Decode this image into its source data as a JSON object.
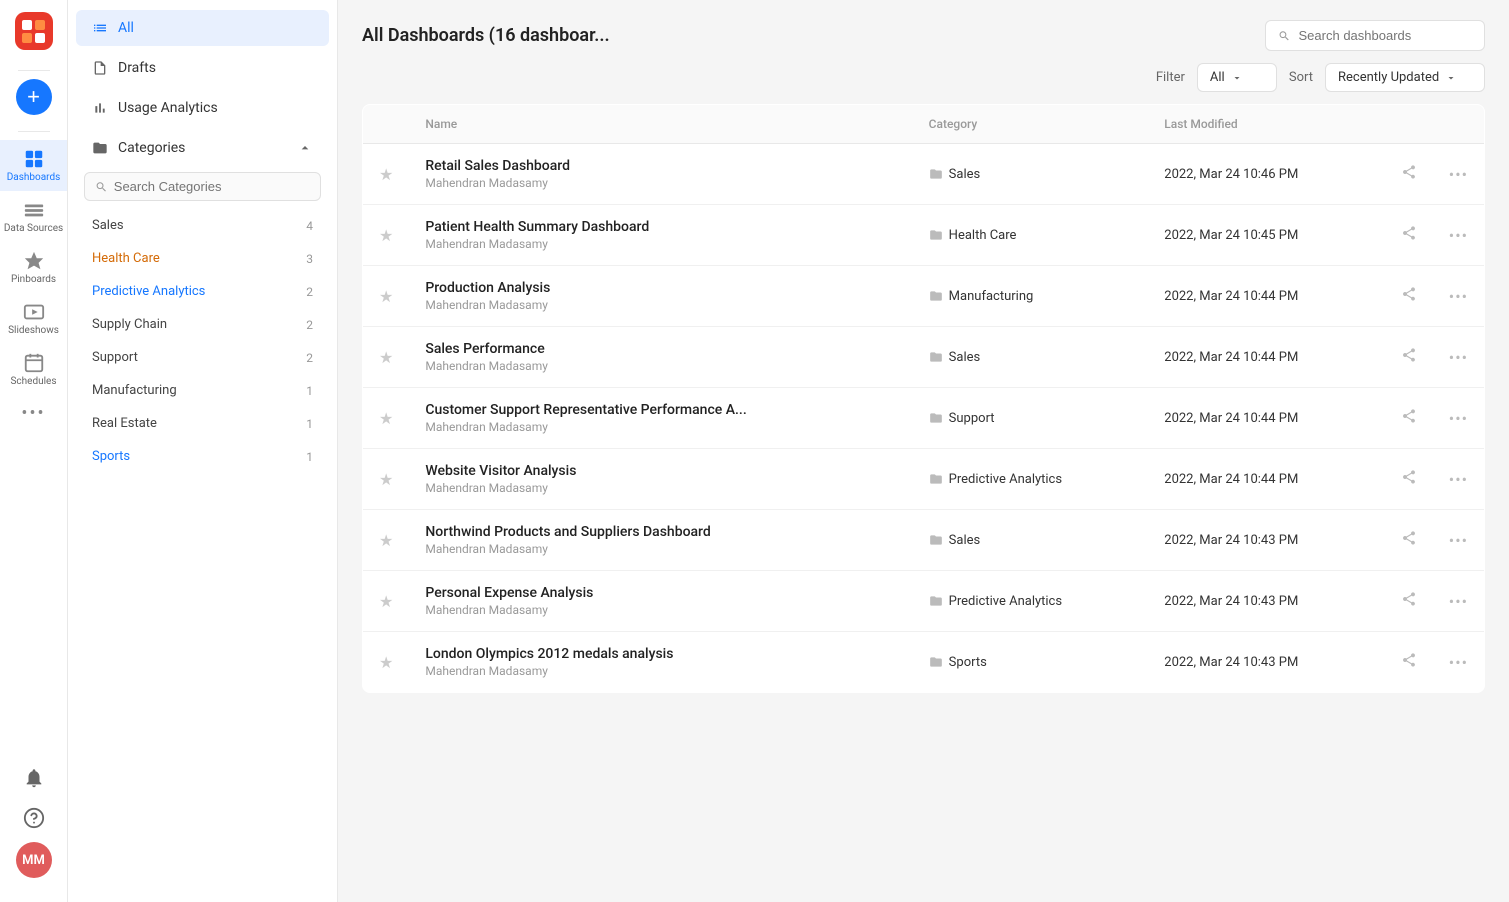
{
  "app": {
    "title": "All Dashboards (16 dashboar..."
  },
  "iconbar": {
    "nav_items": [
      {
        "id": "dashboards",
        "label": "Dashboards",
        "active": true
      },
      {
        "id": "data-sources",
        "label": "Data Sources",
        "active": false
      },
      {
        "id": "pinboards",
        "label": "Pinboards",
        "active": false
      },
      {
        "id": "slideshows",
        "label": "Slideshows",
        "active": false
      },
      {
        "id": "schedules",
        "label": "Schedules",
        "active": false
      }
    ],
    "more_label": "•••",
    "avatar_initials": "MM"
  },
  "sidebar": {
    "all_label": "All",
    "drafts_label": "Drafts",
    "usage_analytics_label": "Usage Analytics",
    "categories_label": "Categories",
    "search_placeholder": "Search Categories",
    "categories": [
      {
        "name": "Sales",
        "count": 4,
        "color": "default"
      },
      {
        "name": "Health Care",
        "count": 3,
        "color": "orange"
      },
      {
        "name": "Predictive Analytics",
        "count": 2,
        "color": "blue"
      },
      {
        "name": "Supply Chain",
        "count": 2,
        "color": "default"
      },
      {
        "name": "Support",
        "count": 2,
        "color": "default"
      },
      {
        "name": "Manufacturing",
        "count": 1,
        "color": "default"
      },
      {
        "name": "Real Estate",
        "count": 1,
        "color": "default"
      },
      {
        "name": "Sports",
        "count": 1,
        "color": "blue"
      }
    ]
  },
  "filter": {
    "label": "Filter",
    "filter_value": "All",
    "sort_label": "Sort",
    "sort_value": "Recently Updated"
  },
  "table": {
    "headers": [
      "",
      "Name",
      "Category",
      "Last Modified",
      "",
      ""
    ],
    "rows": [
      {
        "name": "Retail Sales Dashboard",
        "author": "Mahendran Madasamy",
        "category": "Sales",
        "modified": "2022, Mar 24 10:46 PM",
        "starred": false
      },
      {
        "name": "Patient Health Summary Dashboard",
        "author": "Mahendran Madasamy",
        "category": "Health Care",
        "modified": "2022, Mar 24 10:45 PM",
        "starred": false
      },
      {
        "name": "Production Analysis",
        "author": "Mahendran Madasamy",
        "category": "Manufacturing",
        "modified": "2022, Mar 24 10:44 PM",
        "starred": false
      },
      {
        "name": "Sales Performance",
        "author": "Mahendran Madasamy",
        "category": "Sales",
        "modified": "2022, Mar 24 10:44 PM",
        "starred": false
      },
      {
        "name": "Customer Support Representative Performance A...",
        "author": "Mahendran Madasamy",
        "category": "Support",
        "modified": "2022, Mar 24 10:44 PM",
        "starred": false
      },
      {
        "name": "Website Visitor Analysis",
        "author": "Mahendran Madasamy",
        "category": "Predictive Analytics",
        "modified": "2022, Mar 24 10:44 PM",
        "starred": false
      },
      {
        "name": "Northwind Products and Suppliers Dashboard",
        "author": "Mahendran Madasamy",
        "category": "Sales",
        "modified": "2022, Mar 24 10:43 PM",
        "starred": false
      },
      {
        "name": "Personal Expense Analysis",
        "author": "Mahendran Madasamy",
        "category": "Predictive Analytics",
        "modified": "2022, Mar 24 10:43 PM",
        "starred": false
      },
      {
        "name": "London Olympics 2012 medals analysis",
        "author": "Mahendran Madasamy",
        "category": "Sports",
        "modified": "2022, Mar 24 10:43 PM",
        "starred": false
      }
    ]
  }
}
